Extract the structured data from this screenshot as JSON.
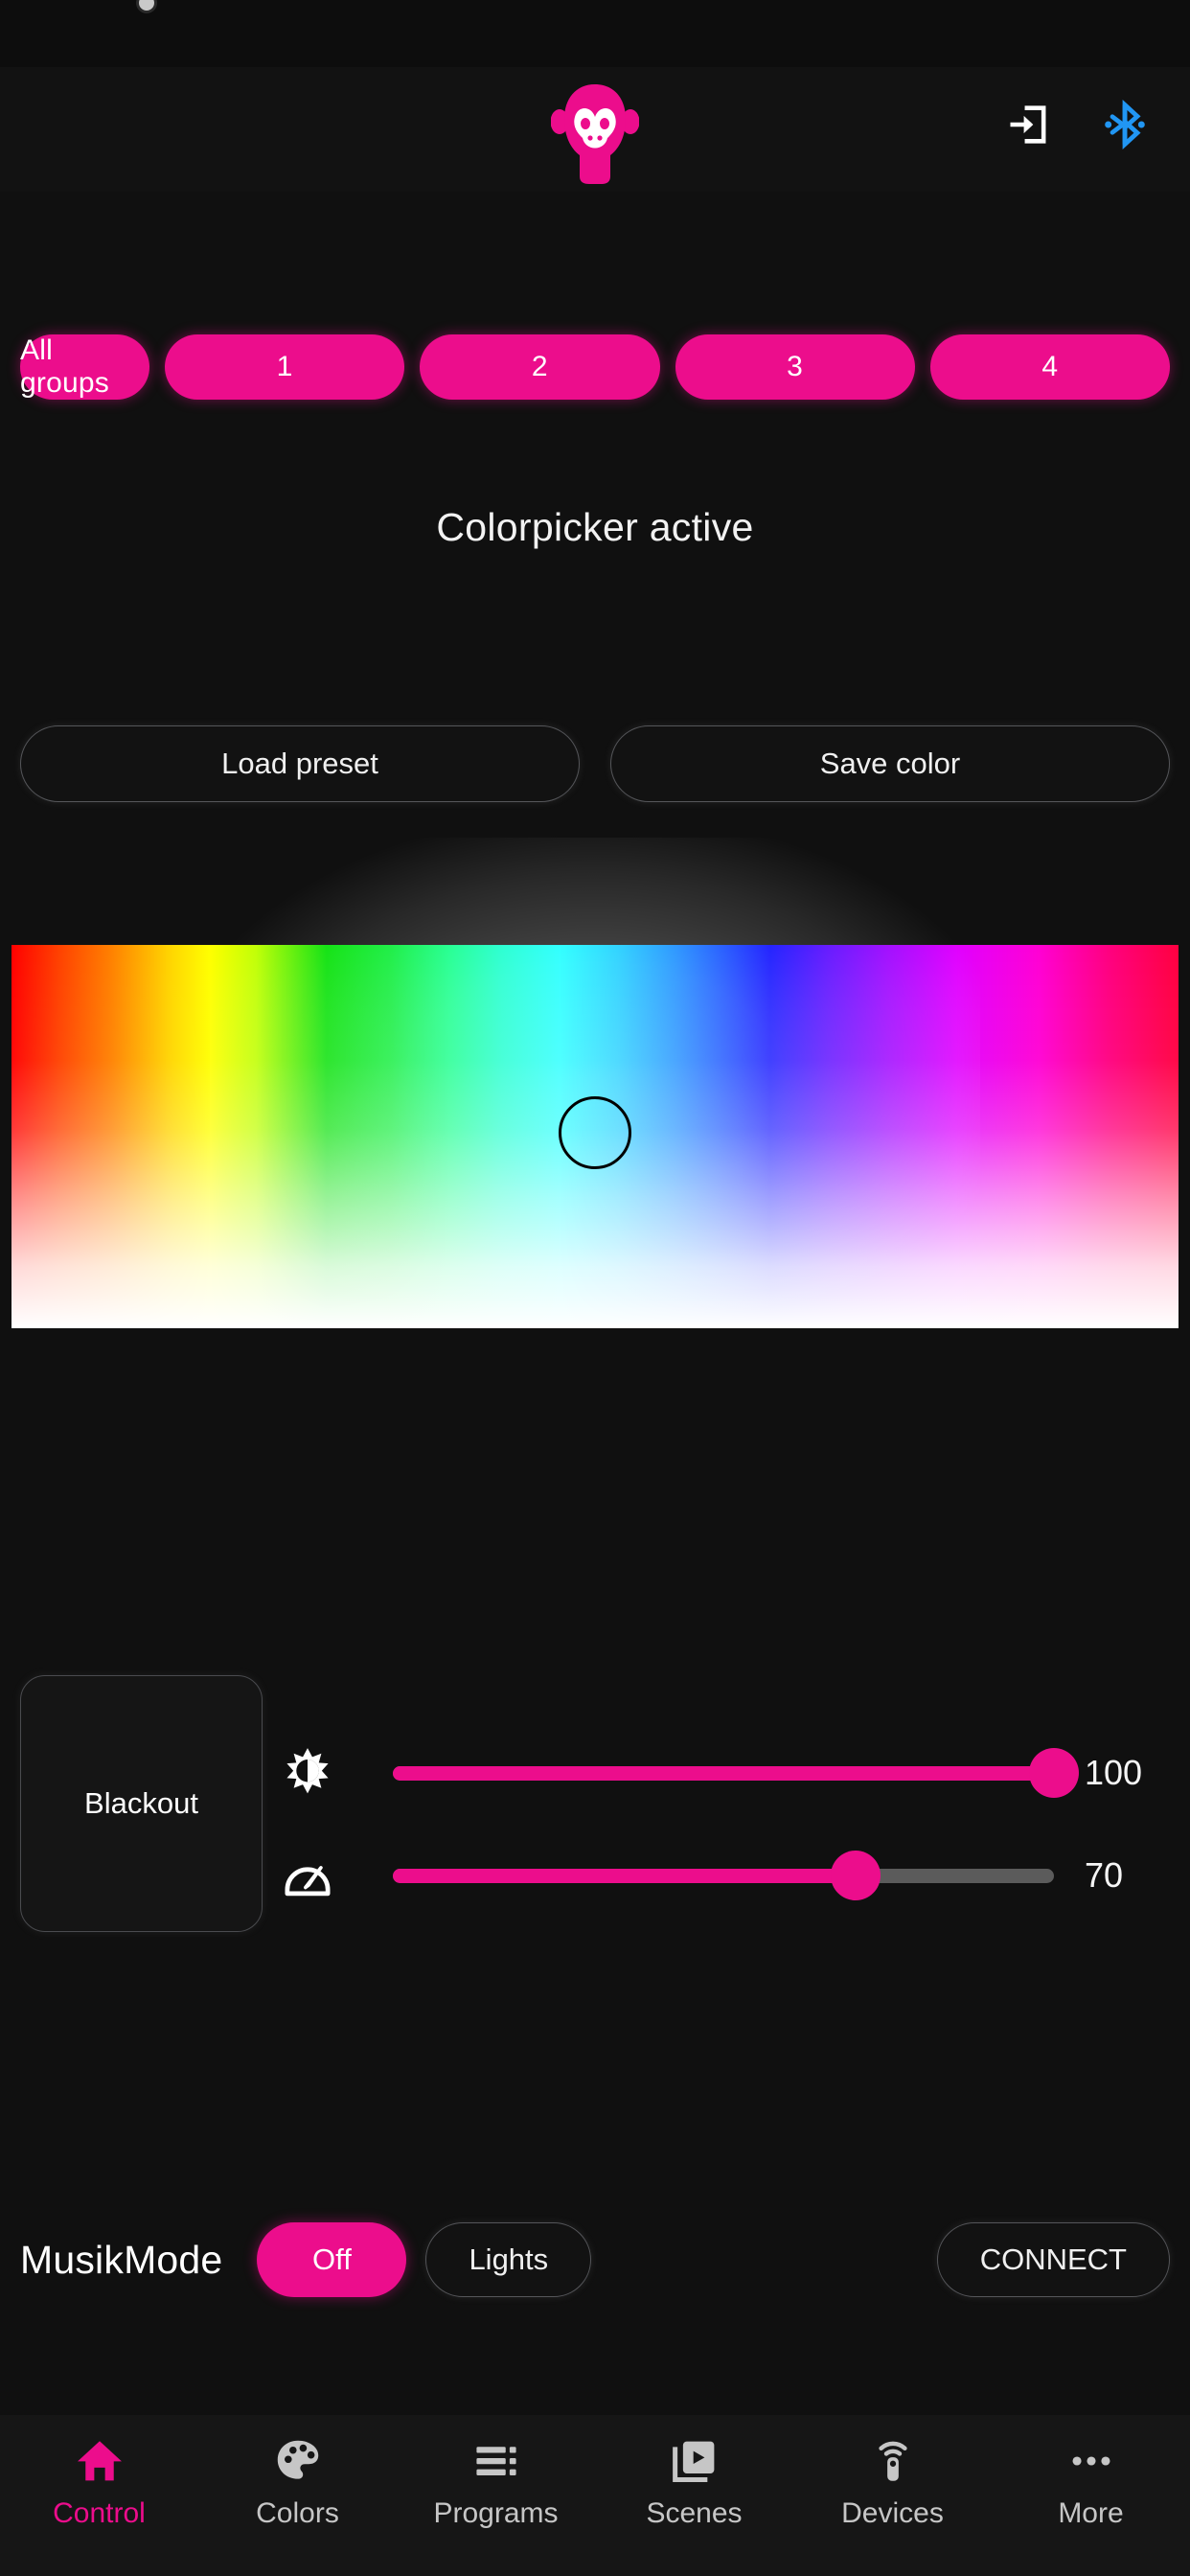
{
  "theme": {
    "background": "#101010",
    "accent": "#ec0d8c",
    "bluetooth_blue": "#2196f3",
    "text": "#ffffff",
    "muted_text": "#c6c6c6",
    "outline": "#55565a"
  },
  "header": {
    "logo_icon": "monkey-head-logo",
    "login_icon": "login-arrow-icon",
    "bluetooth_icon": "bluetooth-icon"
  },
  "groups": {
    "items": [
      {
        "label": "All groups",
        "selected": true
      },
      {
        "label": "1",
        "selected": true
      },
      {
        "label": "2",
        "selected": true
      },
      {
        "label": "3",
        "selected": true
      },
      {
        "label": "4",
        "selected": true
      }
    ]
  },
  "status": {
    "title": "Colorpicker active"
  },
  "presets": {
    "load_label": "Load preset",
    "save_label": "Save color"
  },
  "colorpicker": {
    "handle_x_pct": 50,
    "handle_y_pct": 49,
    "selected_color": "#2ee8c0"
  },
  "controls": {
    "blackout_label": "Blackout",
    "brightness": {
      "icon": "brightness-icon",
      "value": "100",
      "percent": 100
    },
    "speed": {
      "icon": "speed-gauge-icon",
      "value": "70",
      "percent": 70
    }
  },
  "musikmode": {
    "label": "MusikMode",
    "state_label": "Off",
    "lights_label": "Lights",
    "connect_label": "CONNECT"
  },
  "bottom_nav": {
    "items": [
      {
        "label": "Control",
        "icon": "home-icon",
        "active": true
      },
      {
        "label": "Colors",
        "icon": "palette-icon",
        "active": false
      },
      {
        "label": "Programs",
        "icon": "list-icon",
        "active": false
      },
      {
        "label": "Scenes",
        "icon": "library-play-icon",
        "active": false
      },
      {
        "label": "Devices",
        "icon": "remote-control-icon",
        "active": false
      },
      {
        "label": "More",
        "icon": "more-dots-icon",
        "active": false
      }
    ]
  }
}
